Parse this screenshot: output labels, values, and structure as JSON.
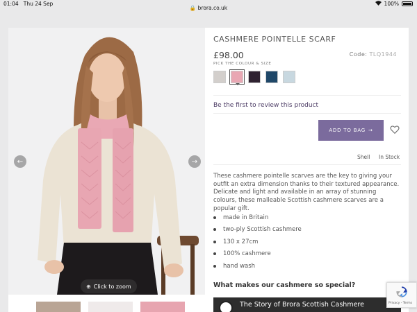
{
  "status_bar": {
    "time": "01:04",
    "date": "Thu 24 Sep",
    "url": "brora.co.uk",
    "battery": "100%"
  },
  "gallery": {
    "zoom_label": "Click to zoom",
    "thumbnail_count": 3
  },
  "product": {
    "title": "CASHMERE POINTELLE SCARF",
    "price": "£98.00",
    "code_label": "Code:",
    "code_value": "TLQ1944",
    "pick_label": "PICK THE COLOUR & SIZE",
    "swatches": [
      {
        "color": "#d3cfcc",
        "selected": false
      },
      {
        "color": "#e9a7b3",
        "selected": true
      },
      {
        "color": "#2f2231",
        "selected": false
      },
      {
        "color": "#1f4768",
        "selected": false
      },
      {
        "color": "#c8d8e0",
        "selected": false
      }
    ],
    "review_link": "Be the first to review this product",
    "add_to_bag": "ADD TO BAG",
    "shade": "Shell",
    "stock": "In Stock",
    "description": "These cashmere pointelle scarves are the key to giving your outfit an extra dimension thanks to their textured appearance. Delicate and light and available in an array of stunning colours, these malleable Scottish cashmere scarves are a popular gift.",
    "features": [
      "made in Britain",
      "two-ply Scottish cashmere",
      "130 x 27cm",
      "100% cashmere",
      "hand wash"
    ],
    "subheading": "What makes our cashmere so special?",
    "video_title": "The Story of Brora Scottish Cashmere"
  },
  "recaptcha": {
    "text": "Privacy - Terms"
  },
  "colors": {
    "accent": "#7b6b9d",
    "link": "#4a3a63"
  }
}
